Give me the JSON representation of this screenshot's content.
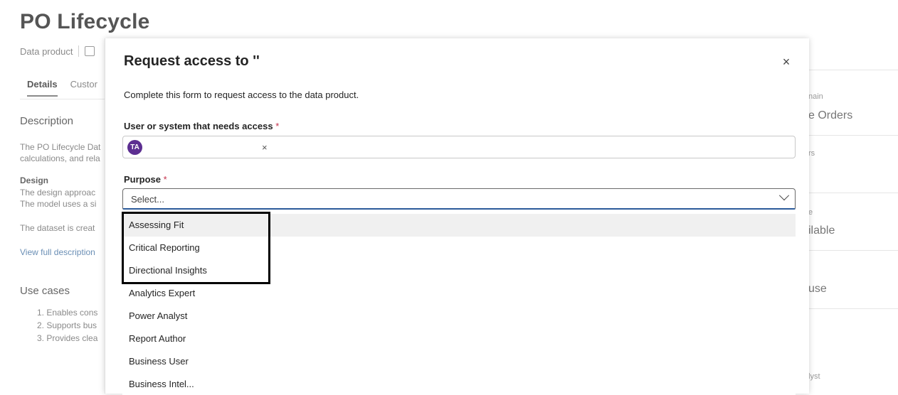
{
  "page": {
    "title": "PO Lifecycle",
    "subtitle_type": "Data product",
    "tabs": [
      "Details",
      "Custor"
    ],
    "description_heading": "Description",
    "description_lines": [
      "The PO Lifecycle Dat",
      "calculations, and rela"
    ],
    "design_heading": "Design",
    "design_lines": [
      "The design approac",
      "The model uses a si"
    ],
    "dataset_line": "The dataset is creat",
    "view_link": "View full description",
    "use_cases_heading": "Use cases",
    "use_cases": [
      "1. Enables cons",
      "2. Supports bus",
      "3. Provides clea"
    ]
  },
  "right_panel": {
    "domain_label": "nain",
    "domain_value": "e Orders",
    "owners_label": "rs",
    "status_label": "e",
    "status_value": "ilable",
    "use_value": "use",
    "role_value": "lyst"
  },
  "dialog": {
    "title": "Request access to ''",
    "close_glyph": "×",
    "description": "Complete this form to request access to the data product.",
    "user_label": "User or system that needs access",
    "required_mark": "*",
    "user_chip": {
      "initials": "TA",
      "remove_glyph": "×",
      "avatar_color": "#5c2e91"
    },
    "purpose_label": "Purpose",
    "purpose_placeholder": "Select...",
    "options": [
      "Assessing Fit",
      "Critical Reporting",
      "Directional Insights",
      "Analytics Expert",
      "Power Analyst",
      "Report Author",
      "Business User",
      "Business Intel..."
    ]
  }
}
